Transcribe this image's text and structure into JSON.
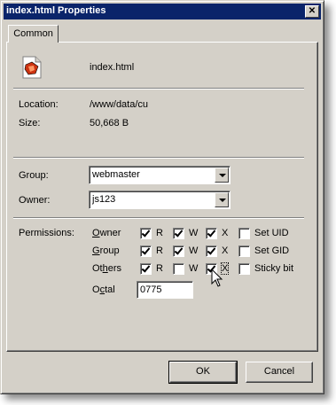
{
  "window": {
    "title": "index.html Properties",
    "close_label": "✕"
  },
  "tab": {
    "label": "Common"
  },
  "file": {
    "name": "index.html",
    "icon": "html-file-icon"
  },
  "info": {
    "location_label": "Location:",
    "location_value": "/www/data/cu",
    "size_label": "Size:",
    "size_value": "50,668 B"
  },
  "group": {
    "label": "Group:",
    "value": "webmaster"
  },
  "owner": {
    "label": "Owner:",
    "value": "js123"
  },
  "permissions": {
    "label": "Permissions:",
    "rows": [
      {
        "name": "Owner",
        "r": true,
        "w": true,
        "x": true,
        "special": "Set UID",
        "special_checked": false
      },
      {
        "name": "Group",
        "r": true,
        "w": true,
        "x": true,
        "special": "Set GID",
        "special_checked": false
      },
      {
        "name": "Others",
        "r": true,
        "w": false,
        "x": true,
        "special": "Sticky bit",
        "special_checked": false
      }
    ],
    "r_label": "R",
    "w_label": "W",
    "x_label": "X",
    "octal_label": "Octal",
    "octal_value": "0775"
  },
  "buttons": {
    "ok": "OK",
    "cancel": "Cancel"
  }
}
